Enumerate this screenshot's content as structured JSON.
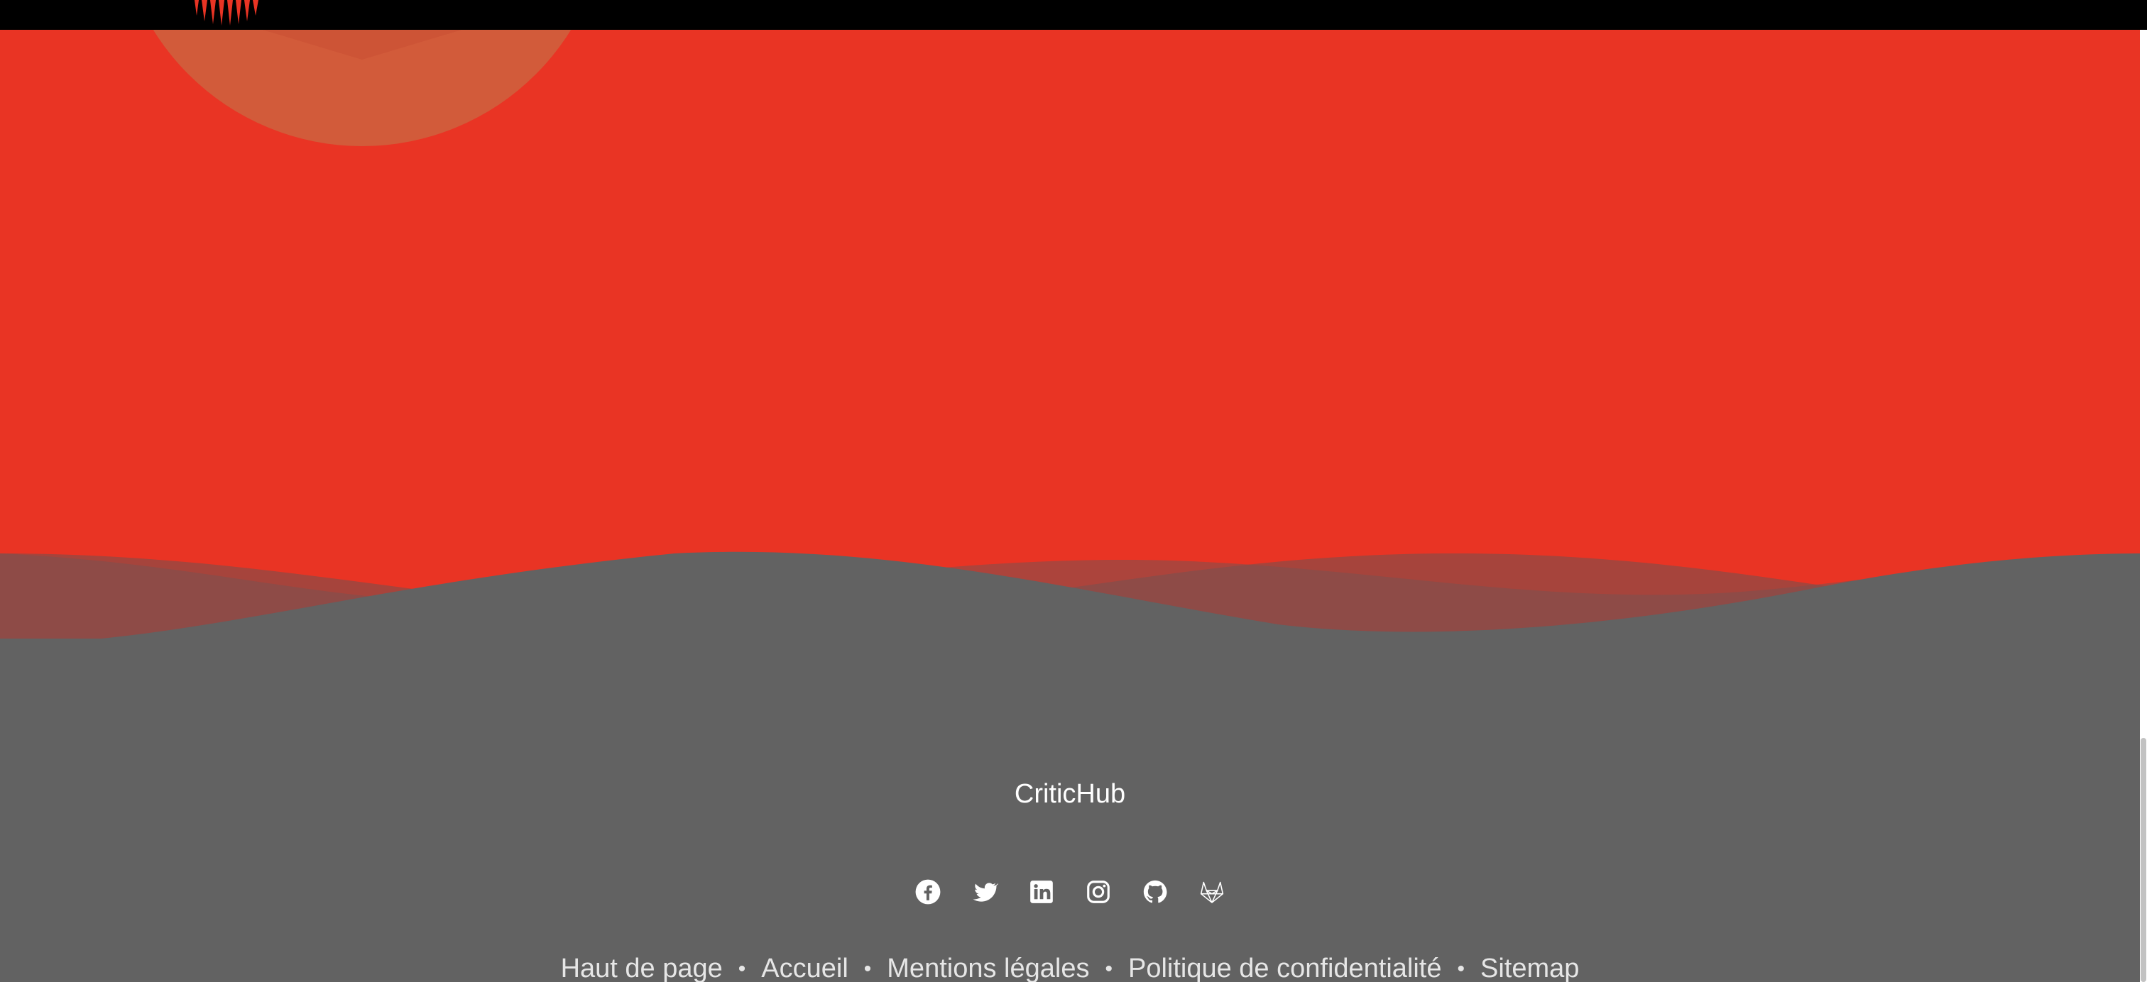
{
  "brand": {
    "name": "CriticHub"
  },
  "colors": {
    "hero": "#e93424",
    "footer": "#626262",
    "topbar": "#000000",
    "circle": "#d25b3a"
  },
  "social": [
    {
      "name": "facebook-icon"
    },
    {
      "name": "twitter-icon"
    },
    {
      "name": "linkedin-icon"
    },
    {
      "name": "instagram-icon"
    },
    {
      "name": "github-icon"
    },
    {
      "name": "gitlab-icon"
    }
  ],
  "footer_links": [
    {
      "label": "Haut de page"
    },
    {
      "label": "Accueil"
    },
    {
      "label": "Mentions légales"
    },
    {
      "label": "Politique de confidentialité"
    },
    {
      "label": "Sitemap"
    }
  ],
  "separator": "•"
}
